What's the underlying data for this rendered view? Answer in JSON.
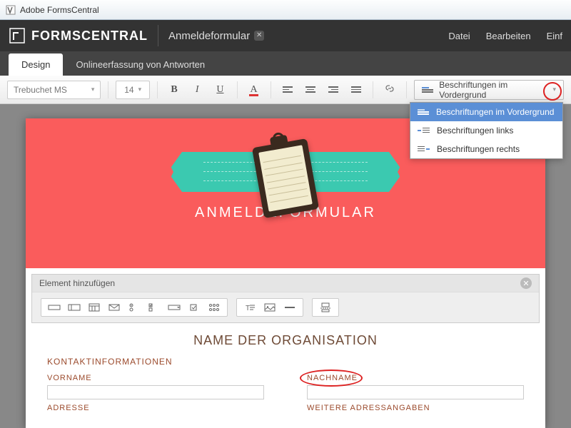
{
  "window": {
    "title": "Adobe FormsCentral"
  },
  "header": {
    "brand": "FORMSCENTRAL",
    "doc_title": "Anmeldeformular",
    "menu": {
      "file": "Datei",
      "edit": "Bearbeiten",
      "insert": "Einf"
    }
  },
  "tabs": {
    "design": "Design",
    "responses": "Onlineerfassung von Antworten"
  },
  "toolbar": {
    "font": "Trebuchet MS",
    "size": "14",
    "label_position_selected": "Beschriftungen im Vordergrund",
    "label_position_options": [
      "Beschriftungen im Vordergrund",
      "Beschriftungen links",
      "Beschriftungen rechts"
    ]
  },
  "element_bar": {
    "title": "Element hinzufügen"
  },
  "form": {
    "hero_title": "ANMELDEFORMULAR",
    "org_title": "NAME DER ORGANISATION",
    "section": "KONTAKTINFORMATIONEN",
    "fields": {
      "vorname": "VORNAME",
      "nachname": "NACHNAME",
      "adresse": "ADRESSE",
      "weitere": "WEITERE ADRESSANGABEN"
    }
  }
}
